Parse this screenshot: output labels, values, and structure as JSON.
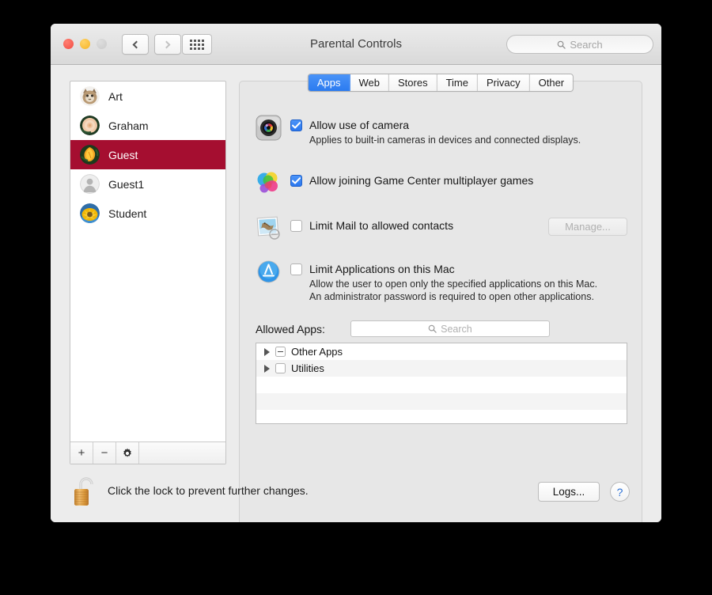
{
  "window": {
    "title": "Parental Controls",
    "traffic_lights": [
      "close",
      "minimize",
      "zoom"
    ],
    "nav": {
      "back": "back-arrow",
      "forward": "forward-arrow",
      "grid": "show-all-grid"
    },
    "search": {
      "placeholder": "Search",
      "value": "",
      "icon": "search-icon"
    }
  },
  "sidebar": {
    "users": [
      {
        "name": "Art",
        "avatar": "cat-photo",
        "selected": false
      },
      {
        "name": "Graham",
        "avatar": "rose-photo",
        "selected": false
      },
      {
        "name": "Guest",
        "avatar": "poppy-photo",
        "selected": true
      },
      {
        "name": "Guest1",
        "avatar": "generic-person",
        "selected": false
      },
      {
        "name": "Student",
        "avatar": "sunflower-photo",
        "selected": false
      }
    ],
    "footer": {
      "add_label": "+",
      "remove_label": "−",
      "gear_label": "gear-icon"
    }
  },
  "tabs": [
    {
      "label": "Apps",
      "active": true
    },
    {
      "label": "Web",
      "active": false
    },
    {
      "label": "Stores",
      "active": false
    },
    {
      "label": "Time",
      "active": false
    },
    {
      "label": "Privacy",
      "active": false
    },
    {
      "label": "Other",
      "active": false
    }
  ],
  "rows": {
    "camera": {
      "icon": "camera-icon",
      "label": "Allow use of camera",
      "checked": true,
      "subtext": "Applies to built-in cameras in devices and connected displays."
    },
    "game_center": {
      "icon": "game-center-icon",
      "label": "Allow joining Game Center multiplayer games",
      "checked": true
    },
    "mail": {
      "icon": "mail-icon",
      "label": "Limit Mail to allowed contacts",
      "checked": false,
      "manage_label": "Manage...",
      "manage_enabled": false
    },
    "applications": {
      "icon": "app-store-icon",
      "label": "Limit Applications on this Mac",
      "checked": false,
      "subtext": "Allow the user to open only the specified applications on this Mac. An administrator password is required to open other applications."
    }
  },
  "allowed_apps": {
    "label": "Allowed Apps:",
    "search": {
      "placeholder": "Search",
      "value": "",
      "icon": "search-icon"
    },
    "items": [
      {
        "name": "Other Apps",
        "state": "mixed",
        "expanded": false
      },
      {
        "name": "Utilities",
        "state": "unchecked",
        "expanded": false
      }
    ]
  },
  "bottom": {
    "lock": {
      "icon": "unlocked-padlock-icon",
      "state": "unlocked"
    },
    "lock_text": "Click the lock to prevent further changes.",
    "logs_label": "Logs...",
    "help_label": "?"
  },
  "colors": {
    "selection": "#a50e30",
    "accent": "#2b7bf0",
    "panel": "#e7e7e7",
    "window": "#ececec"
  }
}
